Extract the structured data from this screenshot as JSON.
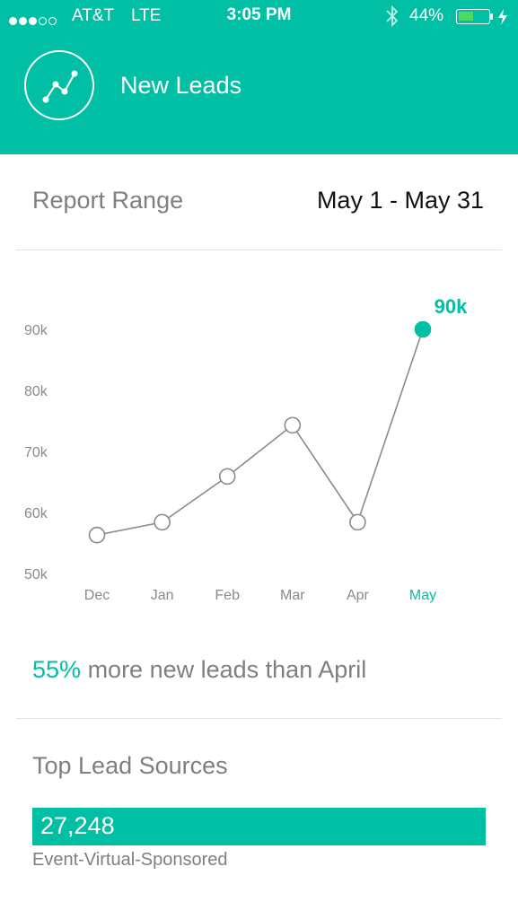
{
  "status_bar": {
    "carrier": "AT&T",
    "network": "LTE",
    "time": "3:05 PM",
    "battery": "44%",
    "battery_level": 0.44,
    "signal_strength": 3,
    "signal_max": 5
  },
  "header": {
    "title": "New Leads",
    "logo_icon": "trend-line-icon",
    "color": "#00bfa5"
  },
  "report": {
    "label": "Report Range",
    "value": "May 1 - May 31"
  },
  "chart_data": {
    "type": "line",
    "categories": [
      "Dec",
      "Jan",
      "Feb",
      "Mar",
      "Apr",
      "May"
    ],
    "values": [
      56.3,
      58.4,
      65.9,
      74.3,
      58.4,
      90
    ],
    "ytick_labels": [
      "90k",
      "80k",
      "70k",
      "60k",
      "50k"
    ],
    "ylim": [
      50,
      90
    ],
    "highlight_index": 5,
    "highlight_label": "90k",
    "grid": false,
    "accent_color": "#00bfa5"
  },
  "summary": {
    "percent": "55%",
    "text": "more new leads than April"
  },
  "lead_sources": {
    "title": "Top Lead Sources",
    "items": [
      {
        "value": "27,248",
        "name": "Event-Virtual-Sponsored"
      }
    ]
  }
}
